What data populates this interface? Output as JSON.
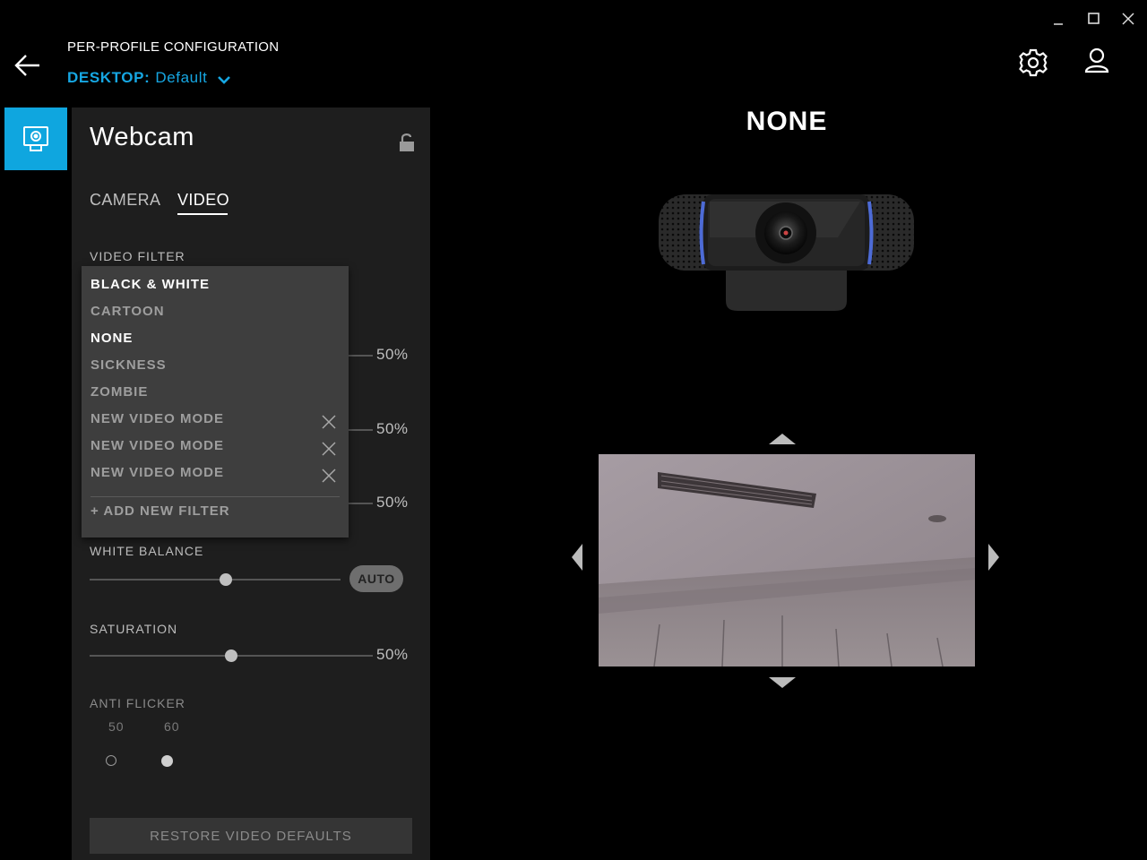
{
  "window": {
    "controls": [
      "minimize",
      "maximize",
      "close"
    ]
  },
  "header": {
    "title": "PER-PROFILE CONFIGURATION",
    "profile_key": "DESKTOP:",
    "profile_value": "Default"
  },
  "panel": {
    "title": "Webcam",
    "tabs": [
      {
        "label": "CAMERA",
        "active": false
      },
      {
        "label": "VIDEO",
        "active": true
      }
    ],
    "video_filter": {
      "label": "VIDEO FILTER",
      "options": [
        {
          "label": "BLACK & WHITE",
          "selected": true,
          "removable": false
        },
        {
          "label": "CARTOON",
          "selected": false,
          "removable": false
        },
        {
          "label": "NONE",
          "selected": true,
          "removable": false
        },
        {
          "label": "SICKNESS",
          "selected": false,
          "removable": false
        },
        {
          "label": "ZOMBIE",
          "selected": false,
          "removable": false
        },
        {
          "label": "NEW VIDEO MODE",
          "selected": false,
          "removable": true
        },
        {
          "label": "NEW VIDEO MODE",
          "selected": false,
          "removable": true
        },
        {
          "label": "NEW VIDEO MODE",
          "selected": false,
          "removable": true
        }
      ],
      "add_label": "+ ADD NEW FILTER"
    },
    "hidden_sliders": [
      {
        "value_label": "50%"
      },
      {
        "value_label": "50%"
      },
      {
        "value_label": "50%"
      }
    ],
    "white_balance": {
      "label": "WHITE BALANCE",
      "auto_label": "AUTO",
      "level": 0.55
    },
    "saturation": {
      "label": "SATURATION",
      "value_label": "50%",
      "level": 0.5
    },
    "anti_flicker": {
      "label": "ANTI FLICKER",
      "options": [
        {
          "label": "50",
          "selected": false
        },
        {
          "label": "60",
          "selected": true
        }
      ]
    },
    "restore_label": "RESTORE VIDEO DEFAULTS"
  },
  "preview": {
    "mode_title": "NONE"
  },
  "colors": {
    "accent": "#16a7e3",
    "panel_bg": "#1e1e1e",
    "dropdown_bg": "#3e3e3e"
  },
  "icons": [
    "back-arrow-icon",
    "chevron-down-icon",
    "gear-icon",
    "user-icon",
    "webcam-icon",
    "unlock-icon",
    "close-icon",
    "arrow-up-icon",
    "arrow-down-icon",
    "arrow-left-icon",
    "arrow-right-icon"
  ]
}
